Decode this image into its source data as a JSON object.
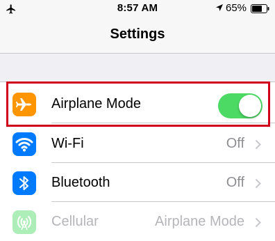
{
  "status_bar": {
    "time": "8:57 AM",
    "battery": "65%",
    "icons": [
      "airplane-icon",
      "location-arrow-icon",
      "battery-icon"
    ]
  },
  "nav": {
    "title": "Settings"
  },
  "rows": [
    {
      "label": "Airplane Mode",
      "icon": "airplane-icon",
      "icon_color": "#ff9500",
      "control": "toggle",
      "toggle_on": true
    },
    {
      "label": "Wi-Fi",
      "icon": "wifi-icon",
      "icon_color": "#007aff",
      "value": "Off"
    },
    {
      "label": "Bluetooth",
      "icon": "bluetooth-icon",
      "icon_color": "#007aff",
      "value": "Off"
    },
    {
      "label": "Cellular",
      "icon": "cellular-antenna-icon",
      "icon_color": "#4cd964",
      "value": "Airplane Mode",
      "disabled": true
    }
  ],
  "colors": {
    "toggle_on": "#4cd964",
    "highlight_box": "#d0021b",
    "background": "#efeff4"
  }
}
